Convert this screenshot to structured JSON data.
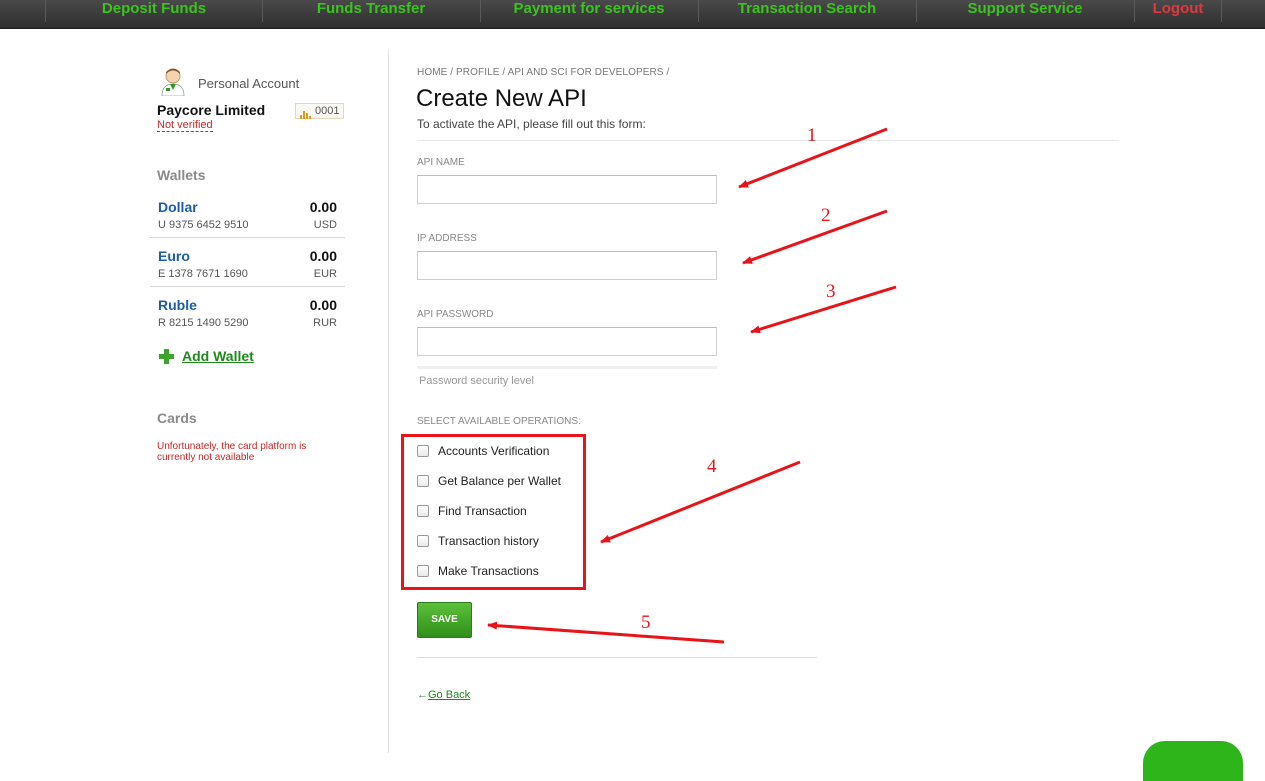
{
  "nav": {
    "items": [
      {
        "label": "Deposit Funds"
      },
      {
        "label": "Funds Transfer"
      },
      {
        "label": "Payment for services"
      },
      {
        "label": "Transaction Search"
      },
      {
        "label": "Support Service"
      }
    ],
    "logout": "Logout"
  },
  "account": {
    "label": "Personal Account",
    "company": "Paycore Limited",
    "status": "Not verified",
    "badge": "0001"
  },
  "wallets": {
    "title": "Wallets",
    "items": [
      {
        "name": "Dollar",
        "number": "U 9375 6452 9510",
        "balance": "0.00",
        "currency": "USD"
      },
      {
        "name": "Euro",
        "number": "E 1378 7671 1690",
        "balance": "0.00",
        "currency": "EUR"
      },
      {
        "name": "Ruble",
        "number": "R 8215 1490 5290",
        "balance": "0.00",
        "currency": "RUR"
      }
    ],
    "add_label": "Add Wallet"
  },
  "cards": {
    "title": "Cards",
    "note": "Unfortunately, the card platform is currently not available"
  },
  "main": {
    "breadcrumb": "HOME / PROFILE / API AND SCI FOR DEVELOPERS /",
    "title": "Create New API",
    "subtitle": "To activate the API, please fill out this form:",
    "fields": {
      "api_name": {
        "label": "API NAME",
        "value": ""
      },
      "ip_address": {
        "label": "IP ADDRESS",
        "value": ""
      },
      "api_password": {
        "label": "API PASSWORD",
        "value": ""
      }
    },
    "password_level": "Password security level",
    "operations_label": "SELECT AVAILABLE OPERATIONS:",
    "operations": [
      {
        "label": "Accounts Verification",
        "checked": false
      },
      {
        "label": "Get Balance per Wallet",
        "checked": false
      },
      {
        "label": "Find Transaction",
        "checked": false
      },
      {
        "label": "Transaction history",
        "checked": false
      },
      {
        "label": "Make Transactions",
        "checked": false
      }
    ],
    "save_label": "SAVE",
    "go_back_arrow": "←",
    "go_back_label": "Go Back"
  },
  "annotations": {
    "numbers": [
      "1",
      "2",
      "3",
      "4",
      "5"
    ],
    "color": "#e8141a"
  },
  "colors": {
    "nav_text": "#3bc31f",
    "logout": "#e0383f",
    "link_blue": "#1a5ea6",
    "save_green": "#2f8f1a",
    "alert_red": "#c62828"
  }
}
